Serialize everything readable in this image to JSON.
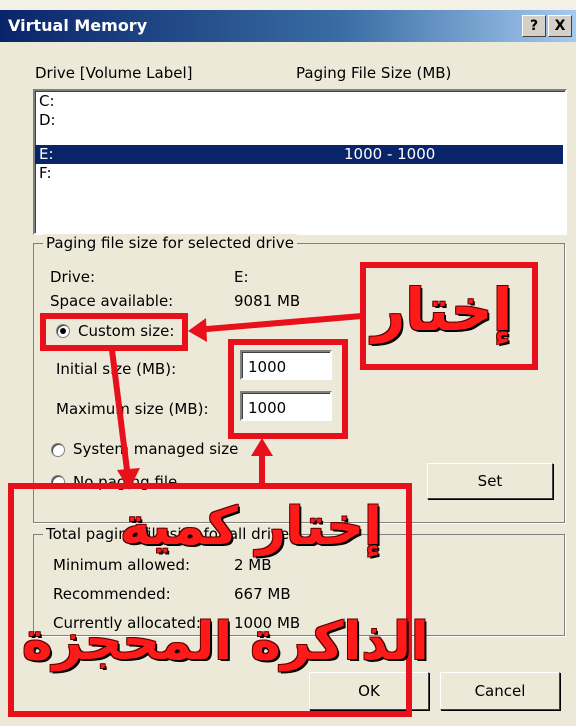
{
  "window": {
    "title": "Virtual Memory",
    "help_label": "?",
    "close_label": "X"
  },
  "drives_header": {
    "drive_col": "Drive  [Volume Label]",
    "size_col": "Paging File Size (MB)"
  },
  "drives": [
    {
      "drive": "C:",
      "size": ""
    },
    {
      "drive": "D:",
      "size": ""
    },
    {
      "drive": "E:",
      "size": "1000 - 1000",
      "selected": true
    },
    {
      "drive": "F:",
      "size": ""
    }
  ],
  "selected_drive": {
    "group_label": "Paging file size for selected drive",
    "drive_label": "Drive:",
    "drive_value": "E:",
    "space_label": "Space available:",
    "space_value": "9081 MB",
    "custom_size_label": "Custom size:",
    "initial_size_label": "Initial size (MB):",
    "initial_size_value": "1000",
    "maximum_size_label": "Maximum size (MB):",
    "maximum_size_value": "1000",
    "system_managed_label": "System managed size",
    "no_paging_label": "No paging file",
    "set_label": "Set"
  },
  "totals": {
    "group_label": "Total paging file size for all drives",
    "minimum_label": "Minimum allowed:",
    "minimum_value": "2 MB",
    "recommended_label": "Recommended:",
    "recommended_value": "667 MB",
    "allocated_label": "Currently allocated:",
    "allocated_value": "1000 MB"
  },
  "buttons": {
    "ok_label": "OK",
    "cancel_label": "Cancel"
  },
  "annotations": {
    "choose": "إختار",
    "choose_amount": "إختار كمية",
    "reserved_memory": "الذاكرة المحجزة"
  },
  "colors": {
    "annotation_red": "#e8101a",
    "selection": "#0a246a"
  }
}
